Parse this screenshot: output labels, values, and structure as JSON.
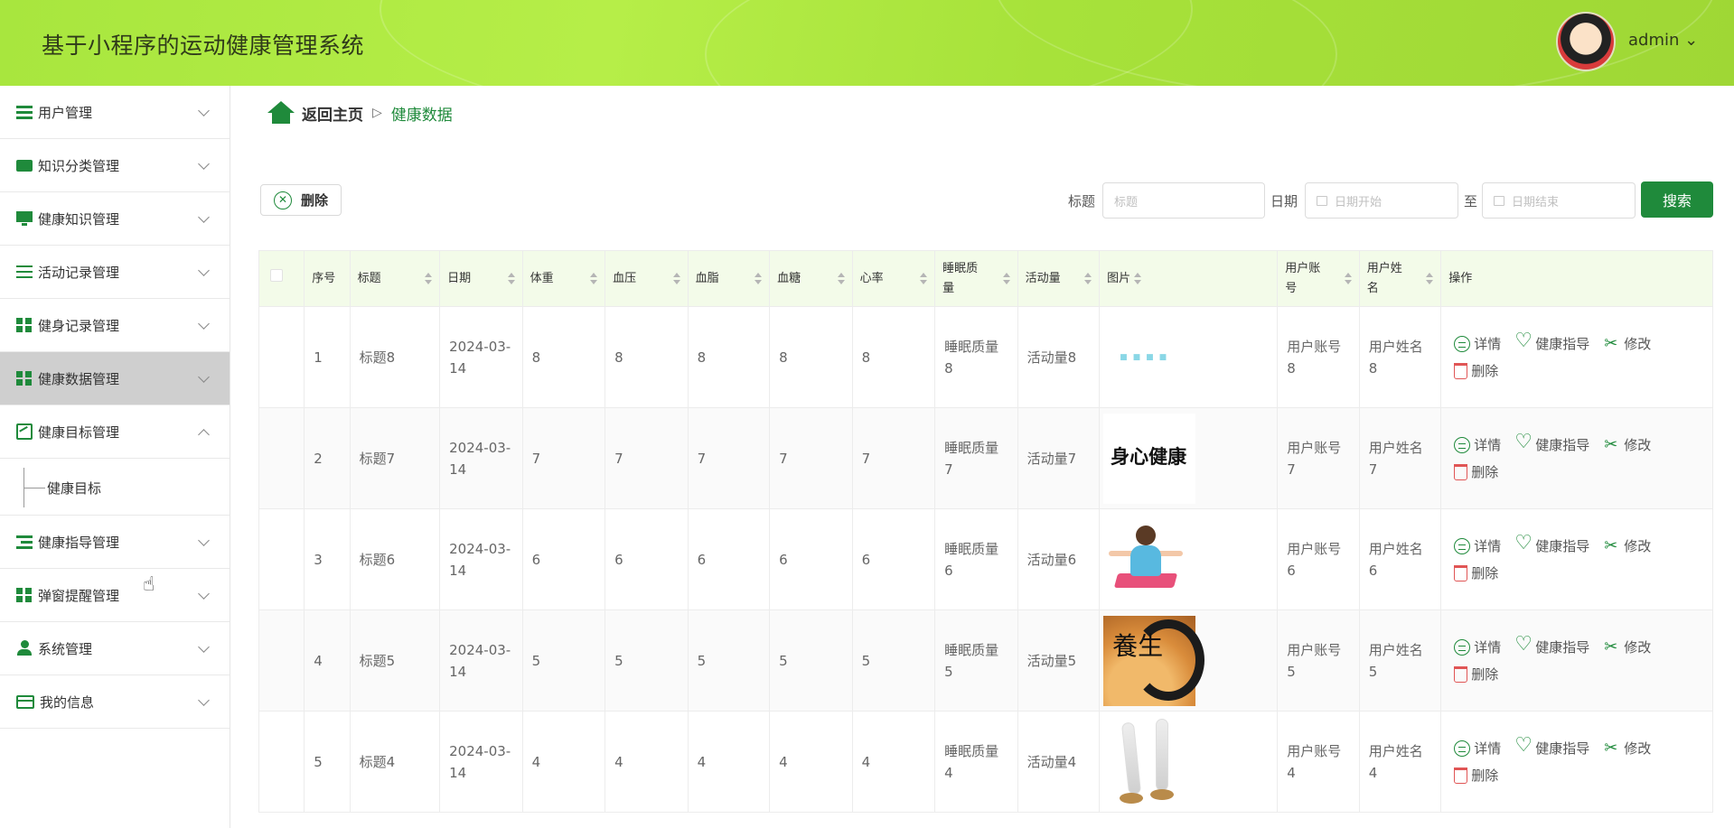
{
  "app": {
    "title": "基于小程序的运动健康管理系统",
    "user": "admin ⌄"
  },
  "sidebar": {
    "items": [
      {
        "label": "用户管理"
      },
      {
        "label": "知识分类管理"
      },
      {
        "label": "健康知识管理"
      },
      {
        "label": "活动记录管理"
      },
      {
        "label": "健身记录管理"
      },
      {
        "label": "健康数据管理"
      },
      {
        "label": "健康目标管理"
      },
      {
        "label": "健康指导管理"
      },
      {
        "label": "弹窗提醒管理"
      },
      {
        "label": "系统管理"
      },
      {
        "label": "我的信息"
      }
    ],
    "submenu_label": "健康目标"
  },
  "breadcrumb": {
    "home": "返回主页",
    "separator": "▷",
    "current": "健康数据"
  },
  "toolbar": {
    "delete_label": "删除",
    "title_label": "标题",
    "title_placeholder": "标题",
    "date_label": "日期",
    "date_start_placeholder": "日期开始",
    "to_label": "至",
    "date_end_placeholder": "日期结束",
    "search_label": "搜索"
  },
  "table": {
    "headers": [
      "序号",
      "标题",
      "日期",
      "体重",
      "血压",
      "血脂",
      "血糖",
      "心率",
      "睡眠质量",
      "活动量",
      "图片",
      "用户账号",
      "用户姓名",
      "操作"
    ],
    "rows": [
      {
        "no": "1",
        "title": "标题8",
        "date": "2024-03-14",
        "weight": "8",
        "bp": "8",
        "lipid": "8",
        "sugar": "8",
        "hr": "8",
        "sleep": "睡眠质量8",
        "activity": "活动量8",
        "account": "用户账号8",
        "name": "用户姓名8",
        "image_text": ""
      },
      {
        "no": "2",
        "title": "标题7",
        "date": "2024-03-14",
        "weight": "7",
        "bp": "7",
        "lipid": "7",
        "sugar": "7",
        "hr": "7",
        "sleep": "睡眠质量7",
        "activity": "活动量7",
        "account": "用户账号7",
        "name": "用户姓名7",
        "image_text": "身心健康"
      },
      {
        "no": "3",
        "title": "标题6",
        "date": "2024-03-14",
        "weight": "6",
        "bp": "6",
        "lipid": "6",
        "sugar": "6",
        "hr": "6",
        "sleep": "睡眠质量6",
        "activity": "活动量6",
        "account": "用户账号6",
        "name": "用户姓名6",
        "image_text": ""
      },
      {
        "no": "4",
        "title": "标题5",
        "date": "2024-03-14",
        "weight": "5",
        "bp": "5",
        "lipid": "5",
        "sugar": "5",
        "hr": "5",
        "sleep": "睡眠质量5",
        "activity": "活动量5",
        "account": "用户账号5",
        "name": "用户姓名5",
        "image_text": "養生"
      },
      {
        "no": "5",
        "title": "标题4",
        "date": "2024-03-14",
        "weight": "4",
        "bp": "4",
        "lipid": "4",
        "sugar": "4",
        "hr": "4",
        "sleep": "睡眠质量4",
        "activity": "活动量4",
        "account": "用户账号4",
        "name": "用户姓名4",
        "image_text": ""
      }
    ],
    "actions": {
      "detail": "详情",
      "guide": "健康指导",
      "edit": "修改",
      "delete": "删除"
    }
  },
  "colors": {
    "primary": "#1f8a3b",
    "header": "#b0ea44",
    "active_menu": "#cfcfcf",
    "table_head": "#f3fbe9"
  }
}
